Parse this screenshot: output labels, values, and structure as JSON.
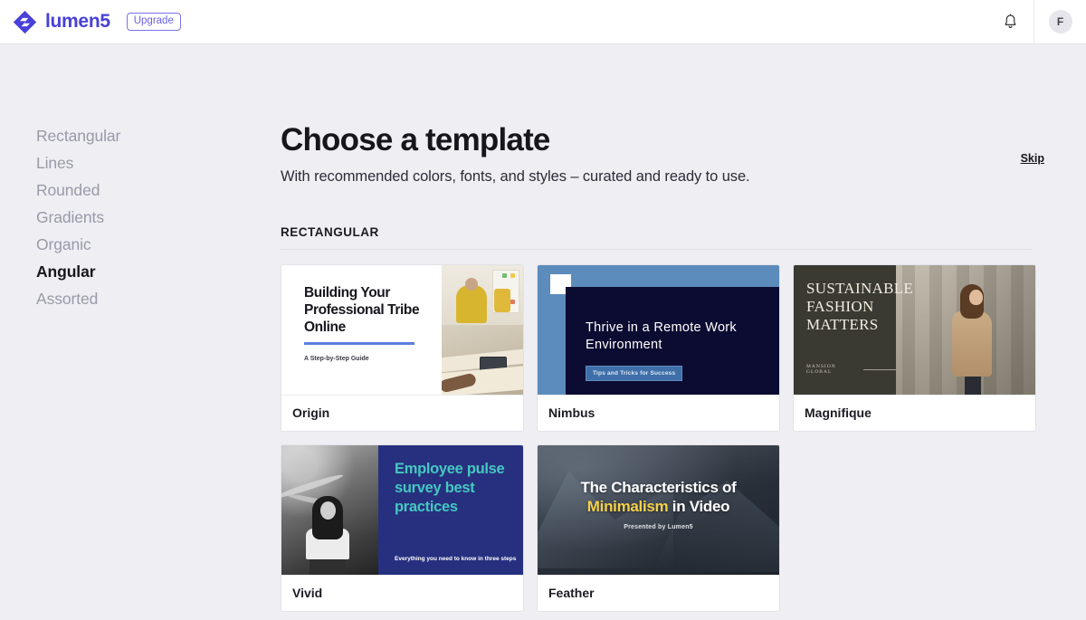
{
  "topbar": {
    "brand_name": "lumen5",
    "upgrade_label": "Upgrade",
    "avatar_initial": "F",
    "accent_color": "#4840d8"
  },
  "sidebar": {
    "items": [
      {
        "label": "Rectangular",
        "active": false
      },
      {
        "label": "Lines",
        "active": false
      },
      {
        "label": "Rounded",
        "active": false
      },
      {
        "label": "Gradients",
        "active": false
      },
      {
        "label": "Organic",
        "active": false
      },
      {
        "label": "Angular",
        "active": true
      },
      {
        "label": "Assorted",
        "active": false
      }
    ]
  },
  "main": {
    "title": "Choose a template",
    "subtitle": "With recommended colors, fonts, and styles – curated and ready to use.",
    "skip_label": "Skip",
    "section_header": "RECTANGULAR"
  },
  "templates": [
    {
      "name": "Origin",
      "style": "origin",
      "headline": "Building Your Professional Tribe Online",
      "subtext": "A Step-by-Step Guide",
      "accent_color": "#5b7fe0",
      "background_color": "#ffffff"
    },
    {
      "name": "Nimbus",
      "style": "nimbus",
      "headline": "Thrive in a Remote Work Environment",
      "badge": "Tips and Tricks for Success",
      "accent_color": "#5b8cbb",
      "background_color": "#0c0c32"
    },
    {
      "name": "Magnifique",
      "style": "magnifique",
      "headline": "SUSTAINABLE FASHION MATTERS",
      "subtext": "MANSION GLOBAL",
      "background_color": "#3a3a33"
    },
    {
      "name": "Vivid",
      "style": "vivid",
      "headline": "Employee pulse survey best practices",
      "subtext": "Everything you need to know in three steps",
      "accent_color": "#45c8c0",
      "background_color": "#27307f"
    },
    {
      "name": "Feather",
      "style": "feather",
      "headline_part1": "The Characteristics of",
      "headline_accent": "Minimalism",
      "headline_part2": " in Video",
      "subtext": "Presented by Lumen5",
      "accent_color": "#f5d04a",
      "background_color": "#2b323c"
    }
  ]
}
